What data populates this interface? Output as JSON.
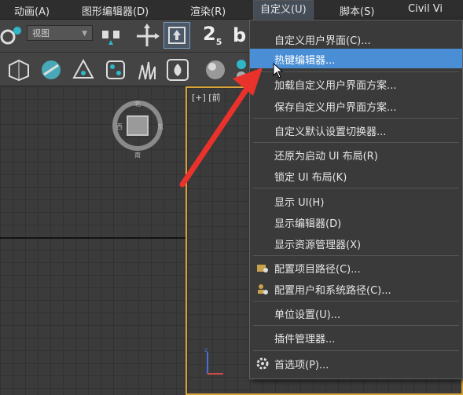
{
  "menubar": {
    "items": [
      "动画(A)",
      "图形编辑器(D)",
      "渲染(R)",
      "自定义(U)",
      "脚本(S)",
      "Civil Vi"
    ]
  },
  "toolbar": {
    "view_select": "视图",
    "snap_label": "2",
    "snap_sub": "5"
  },
  "viewport": {
    "label": "[+] [前"
  },
  "dropdown": {
    "items": [
      {
        "label": "自定义用户界面(C)..."
      },
      {
        "label": "热键编辑器..."
      },
      {
        "label": "加载自定义用户界面方案..."
      },
      {
        "label": "保存自定义用户界面方案..."
      },
      {
        "label": "自定义默认设置切换器..."
      },
      {
        "label": "还原为启动 UI 布局(R)"
      },
      {
        "label": "锁定 UI 布局(K)"
      },
      {
        "label": "显示 UI(H)"
      },
      {
        "label": "显示编辑器(D)"
      },
      {
        "label": "显示资源管理器(X)"
      },
      {
        "label": "配置项目路径(C)..."
      },
      {
        "label": "配置用户和系统路径(C)..."
      },
      {
        "label": "单位设置(U)..."
      },
      {
        "label": "插件管理器..."
      },
      {
        "label": "首选项(P)..."
      }
    ]
  },
  "colors": {
    "highlight": "#4a8fd6",
    "viewport_border": "#d7a33a",
    "arrow": "#e8322b"
  }
}
